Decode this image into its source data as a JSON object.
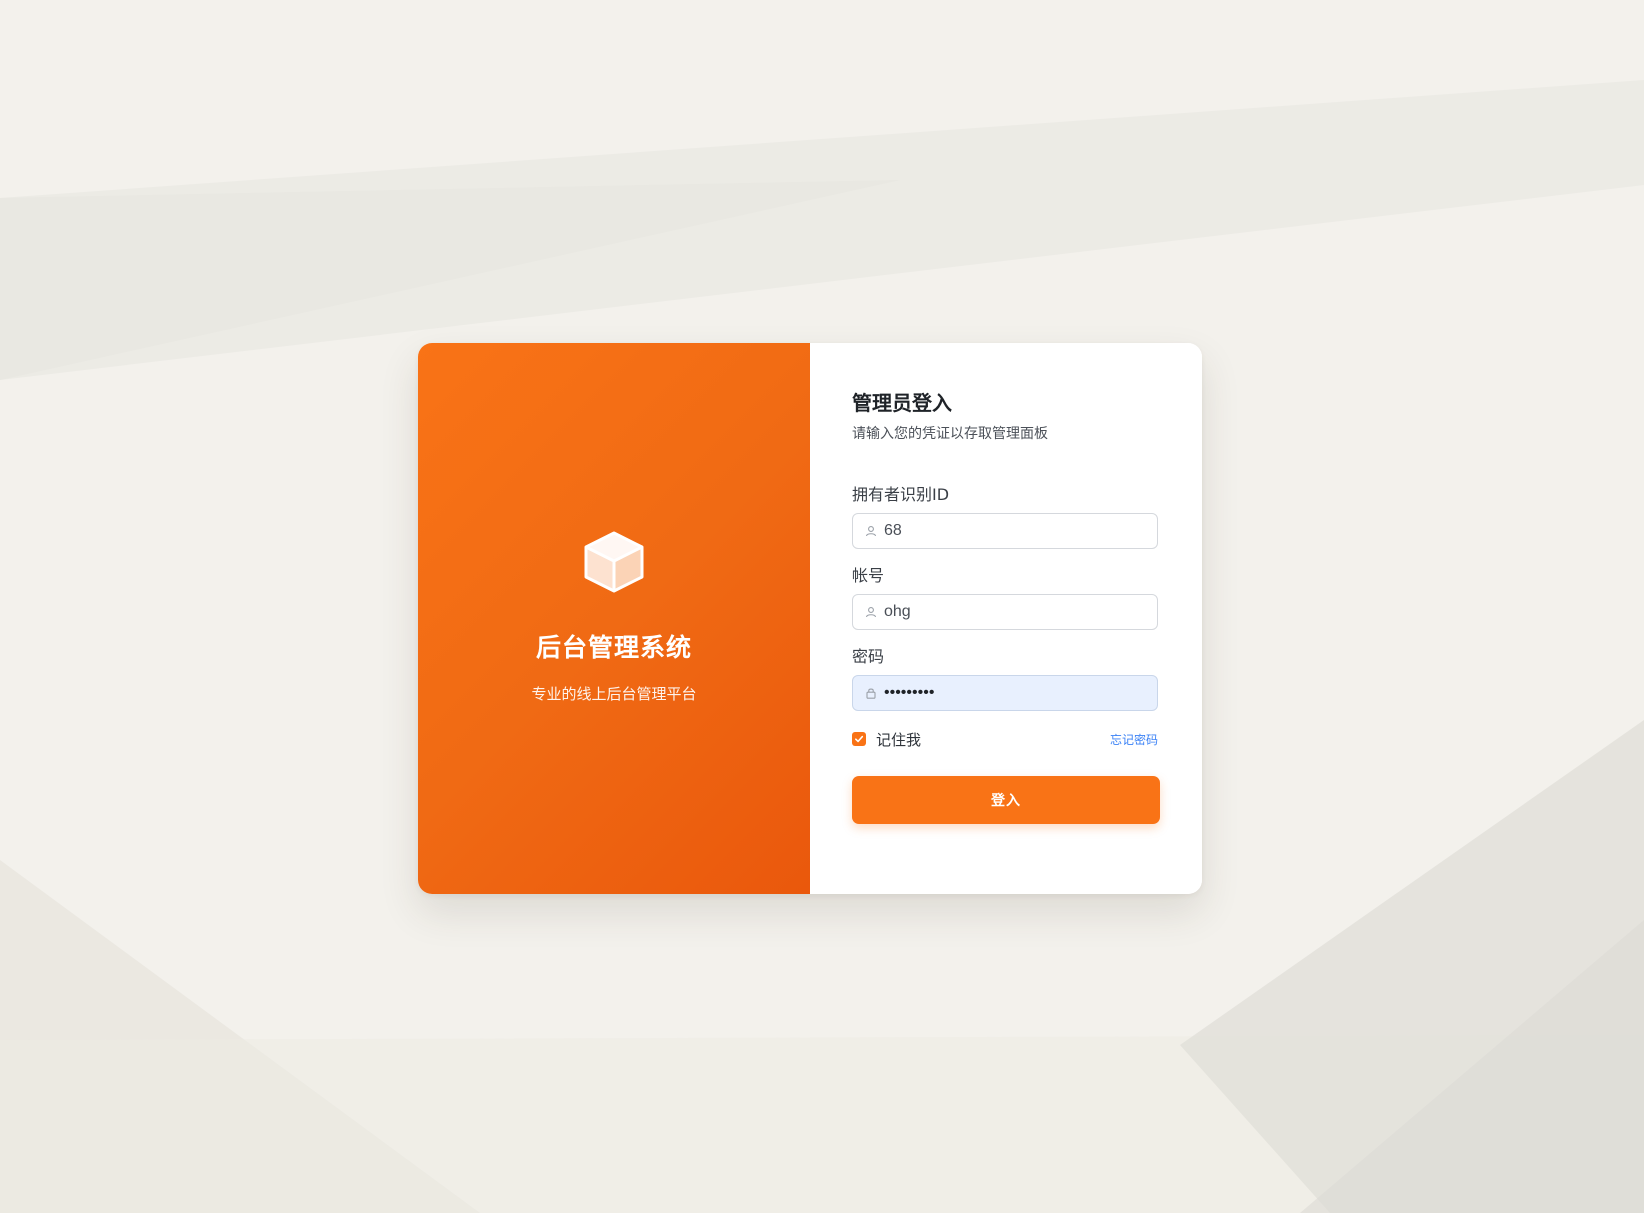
{
  "brand": {
    "logo_icon": "cube-icon",
    "title": "后台管理系统",
    "subtitle": "专业的线上后台管理平台"
  },
  "form": {
    "title": "管理员登入",
    "subtitle": "请输入您的凭证以存取管理面板",
    "fields": {
      "owner_id": {
        "label": "拥有者识别ID",
        "value": "68",
        "icon": "user-icon"
      },
      "account": {
        "label": "帐号",
        "value": "ohg",
        "icon": "user-icon"
      },
      "password": {
        "label": "密码",
        "value": "•••••••••",
        "icon": "lock-icon"
      }
    },
    "remember_me": {
      "label": "记住我",
      "checked": true
    },
    "forgot_password_label": "忘记密码",
    "submit_label": "登入"
  },
  "colors": {
    "accent": "#f97316",
    "accent_dark": "#ea580c",
    "link": "#3b82f6",
    "page_background": "#f3f1ec",
    "autofill_background": "#e8f0fe"
  }
}
